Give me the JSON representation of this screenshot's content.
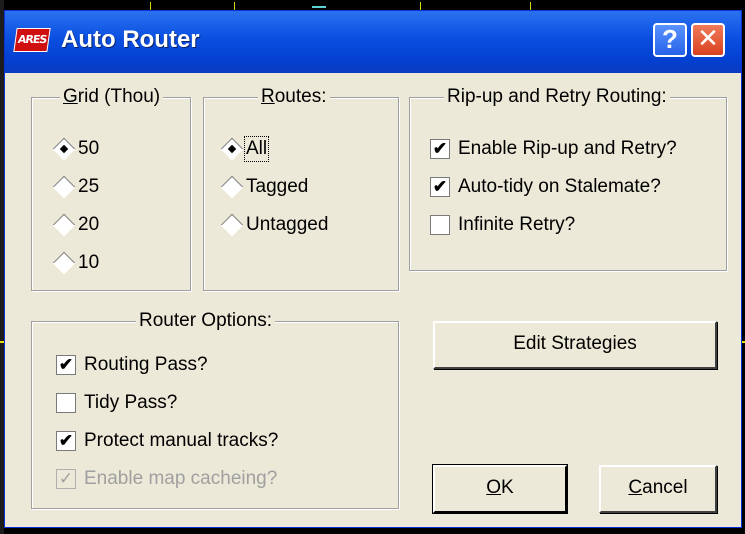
{
  "window": {
    "title": "Auto Router",
    "app_icon_text": "ARES",
    "help_label": "?",
    "close_label": "✕"
  },
  "grid": {
    "legend": "Grid (Thou)",
    "options": [
      "50",
      "25",
      "20",
      "10"
    ],
    "selected": "50"
  },
  "routes": {
    "legend": "Routes:",
    "options": [
      "All",
      "Tagged",
      "Untagged"
    ],
    "selected": "All"
  },
  "ripup": {
    "legend": "Rip-up and Retry Routing:",
    "items": [
      {
        "label": "Enable Rip-up and Retry?",
        "checked": true
      },
      {
        "label": "Auto-tidy on Stalemate?",
        "checked": true
      },
      {
        "label": "Infinite Retry?",
        "checked": false
      }
    ]
  },
  "router_options": {
    "legend": "Router Options:",
    "items": [
      {
        "label": "Routing Pass?",
        "checked": true,
        "enabled": true
      },
      {
        "label": "Tidy Pass?",
        "checked": false,
        "enabled": true
      },
      {
        "label": "Protect manual tracks?",
        "checked": true,
        "enabled": true
      },
      {
        "label": "Enable map cacheing?",
        "checked": true,
        "enabled": false
      }
    ]
  },
  "buttons": {
    "edit_strategies": "Edit Strategies",
    "ok": "OK",
    "cancel": "Cancel"
  },
  "colors": {
    "titlebar": "#0a4ee0",
    "dialog_bg": "#ece9d8",
    "disabled_text": "#a0a0a0"
  }
}
